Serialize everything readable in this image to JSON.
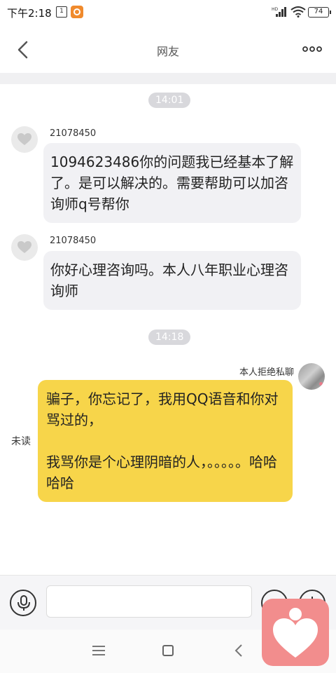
{
  "status_bar": {
    "time": "下午2:18",
    "calendar_badge": "1",
    "battery": "74"
  },
  "header": {
    "title": "网友"
  },
  "messages": [
    {
      "type": "time",
      "text": "14:01"
    },
    {
      "type": "incoming",
      "sender": "21078450",
      "text": "1094623486你的问题我已经基本了解了。是可以解决的。需要帮助可以加咨询师q号帮你"
    },
    {
      "type": "incoming",
      "sender": "21078450",
      "text": "你好心理咨询吗。本人八年职业心理咨询师"
    },
    {
      "type": "time",
      "text": "14:18"
    },
    {
      "type": "outgoing",
      "sender": "本人拒绝私聊",
      "status": "未读",
      "text": "骗子，你忘记了，我用QQ语音和你对骂过的，\n\n我骂你是个心理阴暗的人，。。。。。哈哈哈哈"
    }
  ],
  "input_bar": {
    "placeholder": ""
  },
  "colors": {
    "outgoing_bubble": "#f7d54a",
    "incoming_bubble": "#f1f1f4",
    "floating_app": "#f28d8d"
  }
}
